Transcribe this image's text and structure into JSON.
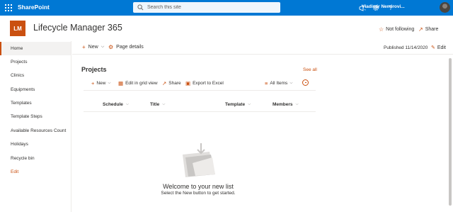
{
  "suite": {
    "brand": "SharePoint",
    "search_placeholder": "Search this site",
    "user_name": "Vladimir Nemirovi...",
    "colors": {
      "suite_bar": "#0078d4",
      "accent": "#ca5010"
    }
  },
  "site": {
    "logo_initials": "LM",
    "title": "Lifecycle Manager 365",
    "follow_label": "Not following",
    "share_label": "Share"
  },
  "nav": {
    "items": [
      {
        "label": "Home"
      },
      {
        "label": "Projects"
      },
      {
        "label": "Clinics"
      },
      {
        "label": "Equipments"
      },
      {
        "label": "Templates"
      },
      {
        "label": "Template Steps"
      },
      {
        "label": "Available Resources Count"
      },
      {
        "label": "Holidays"
      },
      {
        "label": "Recycle bin"
      },
      {
        "label": "Edit"
      }
    ]
  },
  "command_bar": {
    "new_label": "New",
    "page_details_label": "Page details",
    "published": "Published 11/14/2020",
    "edit_label": "Edit"
  },
  "list_webpart": {
    "title": "Projects",
    "see_all": "See all",
    "commands": {
      "new_label": "New",
      "grid_label": "Edit in grid view",
      "share_label": "Share",
      "excel_label": "Export to Excel",
      "view_label": "All Items"
    },
    "columns": [
      "Schedule",
      "Title",
      "Template",
      "Members"
    ],
    "empty_title": "Welcome to your new list",
    "empty_subtitle": "Select the New button to get started."
  }
}
